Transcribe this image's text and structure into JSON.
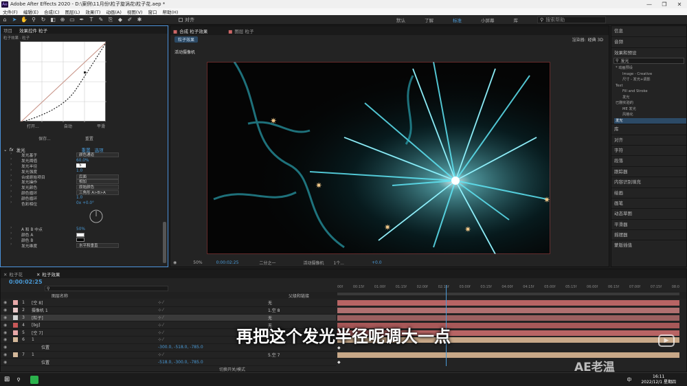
{
  "window": {
    "title": "Adobe After Effects 2020 - D:\\案例\\11月份\\粒子旋涡花\\粒子花.aep *",
    "minimize": "—",
    "maximize": "❐",
    "close": "✕"
  },
  "menu": [
    "文件(F)",
    "编辑(E)",
    "合成(C)",
    "图层(L)",
    "效果(T)",
    "动画(A)",
    "视图(V)",
    "窗口",
    "帮助(H)"
  ],
  "toolbar": {
    "snap_label": "对齐",
    "workspaces": [
      "默认",
      "了解",
      "标准",
      "小屏幕",
      "库"
    ],
    "search_placeholder": "搜索帮助"
  },
  "effect_controls": {
    "tabs": [
      "项目",
      "效果控件 粒子"
    ],
    "breadcrumb": "粒子效果 · 粒子",
    "curve_buttons": [
      "打开...",
      "自动",
      "平滑",
      "保存...",
      "重置"
    ],
    "effect_name": "发光",
    "reset_label": "重置",
    "options_label": "选项",
    "properties": [
      {
        "label": "发光基于",
        "value": "颜色通道",
        "type": "dropdown"
      },
      {
        "label": "发光阈值",
        "value": "60.0%",
        "type": "value"
      },
      {
        "label": "发光半径",
        "value": "5",
        "type": "input"
      },
      {
        "label": "发光强度",
        "value": "1.0",
        "type": "value"
      },
      {
        "label": "合成原始项目",
        "value": "后面",
        "type": "dropdown"
      },
      {
        "label": "发光操作",
        "value": "相加",
        "type": "dropdown"
      },
      {
        "label": "发光颜色",
        "value": "原始颜色",
        "type": "dropdown"
      },
      {
        "label": "颜色循环",
        "value": "三角形 A>B>A",
        "type": "dropdown"
      },
      {
        "label": "颜色循环",
        "value": "1.0",
        "type": "value"
      },
      {
        "label": "色彩相位",
        "value": "0x +0.0°",
        "type": "value"
      }
    ],
    "properties2": [
      {
        "label": "A 和 B 中点",
        "value": "50%",
        "type": "value"
      },
      {
        "label": "颜色 A",
        "value": "",
        "type": "swatch-white"
      },
      {
        "label": "颜色 B",
        "value": "",
        "type": "swatch-black"
      },
      {
        "label": "发光维度",
        "value": "水平和垂直",
        "type": "dropdown"
      }
    ]
  },
  "composition": {
    "tabs": [
      "合成 粒子效果",
      "图层 粒子"
    ],
    "active_comp": "粒子效果",
    "renderer_label": "渲染器:",
    "renderer_value": "经典 3D",
    "camera_label": "活动摄像机",
    "bottom": {
      "zoom": "50%",
      "time": "0:00:02:25",
      "resolution": "二分之一",
      "camera": "活动摄像机",
      "views": "1个...",
      "exposure": "+0.0"
    }
  },
  "right_panel": {
    "top_items": [
      "信息",
      "音频"
    ],
    "effects_title": "效果和预设",
    "search_value": "发光",
    "tree": [
      "* 动画预设",
      "Image - Creative",
      "尺寸 - 发光+调影",
      "Text",
      "Fill and Stroke",
      "发光",
      "已删实验的",
      "ME 发光",
      "风格化",
      "发光"
    ],
    "list": [
      "库",
      "对齐",
      "字符",
      "段落",
      "跟踪器",
      "内容识别填充",
      "绘画",
      "画笔",
      "动态草图",
      "平滑器",
      "摇摆器",
      "蒙版插值"
    ]
  },
  "timeline": {
    "tabs": [
      "粒子花",
      "粒子效果"
    ],
    "current_time": "0:00:02:25",
    "frames": "00085 (30.00 fps)",
    "search_placeholder": "",
    "col_name": "图层名称",
    "col_parent": "父级和链接",
    "ruler": [
      "00f",
      "00:15f",
      "01:00f",
      "01:15f",
      "02:00f",
      "02:15f",
      "03:00f",
      "03:15f",
      "04:00f",
      "04:15f",
      "05:00f",
      "05:15f",
      "06:00f",
      "06:15f",
      "07:00f",
      "07:15f",
      "08:0"
    ],
    "layers": [
      {
        "num": "1",
        "name": "[空 8]",
        "parent": "无",
        "color": "#e8a8a8",
        "bar": "#b86464"
      },
      {
        "num": "2",
        "name": "摄像机 1",
        "parent": "1.空 8",
        "color": "#e8c8c8",
        "bar": "#b07070"
      },
      {
        "num": "3",
        "name": "[粒子]",
        "parent": "无",
        "color": "#d4d4d4",
        "bar": "#9c6060",
        "selected": true
      },
      {
        "num": "4",
        "name": "[bg]",
        "parent": "无",
        "color": "#c85858",
        "bar": "#a85858"
      },
      {
        "num": "5",
        "name": "[空 7]",
        "parent": "无",
        "color": "#e8a8a8",
        "bar": "#b86464"
      },
      {
        "num": "6",
        "name": "1",
        "parent": "",
        "color": "#d4b89a",
        "bar": "#c8a888"
      },
      {
        "num": "",
        "name": "位置",
        "parent": "",
        "value": "-300.0, -518.0, -785.0",
        "sub": true
      },
      {
        "num": "7",
        "name": "1",
        "parent": "5.空 7",
        "color": "#d4b89a",
        "bar": "#c8a888"
      },
      {
        "num": "",
        "name": "位置",
        "parent": "",
        "value": "-518.0, -300.0, -785.0",
        "sub": true
      }
    ],
    "bottom_label": "切换开关/模式"
  },
  "subtitle": "再把这个发光半径呢调大一点",
  "watermark": "AE老温",
  "taskbar": {
    "time": "16:11",
    "date": "2022/12/1 星期四",
    "lang": "中"
  }
}
